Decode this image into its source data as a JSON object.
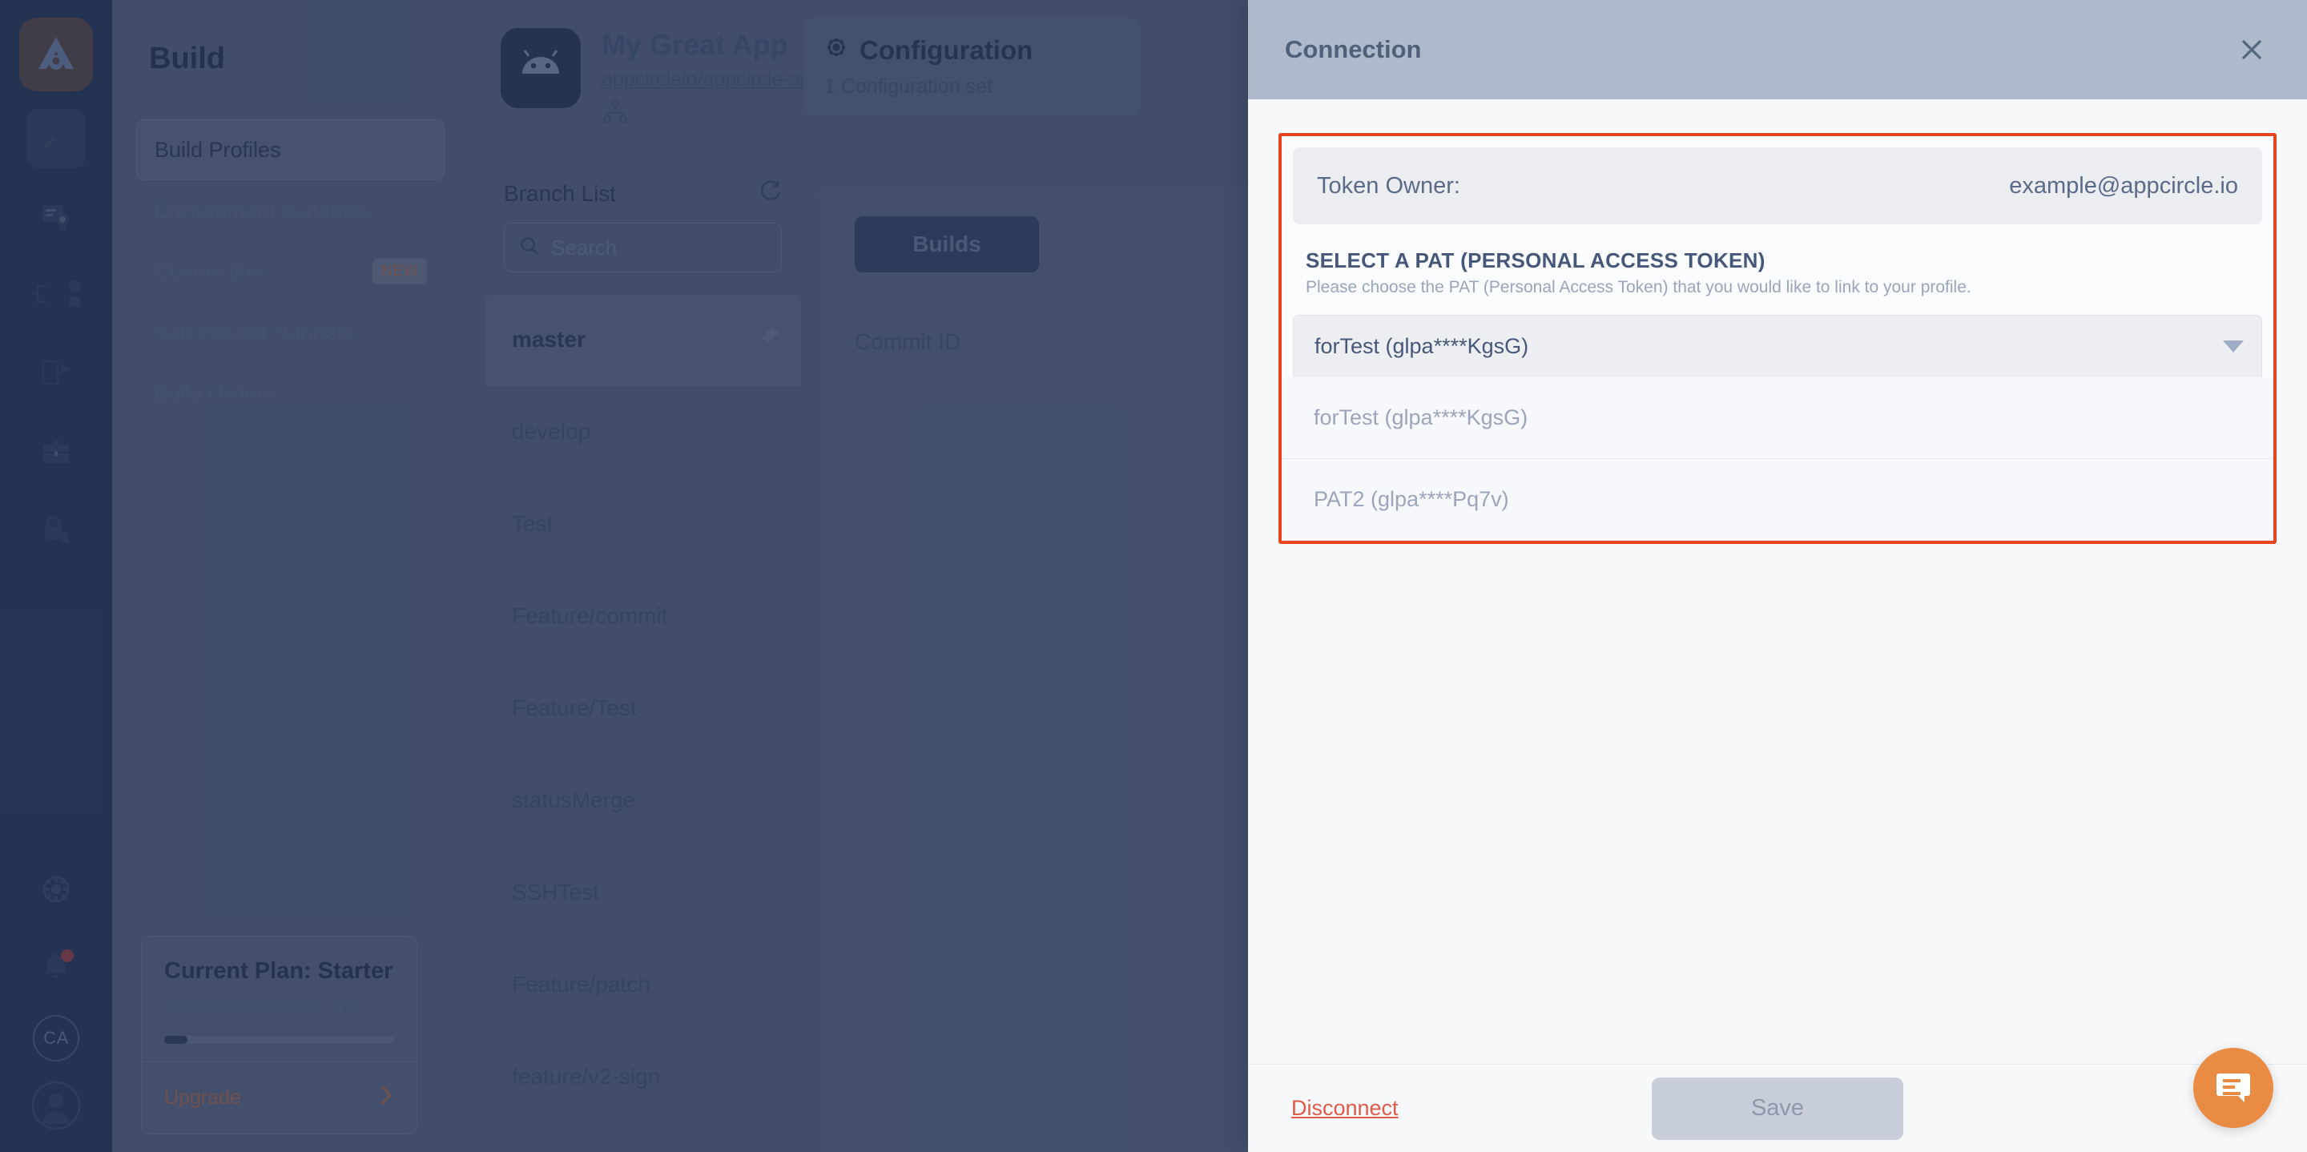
{
  "rail": {
    "items": [
      {
        "name": "appcircle-logo",
        "icon": "appcircle-logo-icon"
      },
      {
        "name": "build",
        "icon": "hammer-icon",
        "active": true
      },
      {
        "name": "signing-identities",
        "icon": "certificate-icon"
      },
      {
        "name": "distribution-flow",
        "icon": "flow-branch-icon"
      },
      {
        "name": "testing-distribution",
        "icon": "phone-send-icon"
      },
      {
        "name": "store-submit",
        "icon": "briefcase-icon"
      },
      {
        "name": "enterprise-app-store",
        "icon": "lock-person-icon"
      }
    ],
    "bottom": [
      {
        "name": "settings",
        "icon": "gear-icon"
      },
      {
        "name": "notifications",
        "icon": "bell-icon"
      },
      {
        "name": "organization",
        "icon": "ca-avatar",
        "label": "CA"
      },
      {
        "name": "profile",
        "icon": "user-circle-icon"
      }
    ]
  },
  "leftnav": {
    "title": "Build",
    "items": [
      {
        "label": "Build Profiles",
        "selected": true,
        "badge": ""
      },
      {
        "label": "Environment Variables",
        "selected": false,
        "badge": ""
      },
      {
        "label": "Connections",
        "selected": false,
        "badge": "NEW"
      },
      {
        "label": "Self-Hosted Runners",
        "selected": false,
        "badge": ""
      },
      {
        "label": "Build History",
        "selected": false,
        "badge": ""
      }
    ],
    "plan": {
      "title": "Current Plan: Starter",
      "remaining": "Remaining Builds: 18",
      "progress_percent": 10,
      "upgrade_label": "Upgrade",
      "chevron": "chevron-right-icon"
    }
  },
  "app": {
    "name": "My Great App",
    "repo": "appcircleio/appcircle-sample-android",
    "platform_icon": "android-icon",
    "branch_icon": "git-branch-icon",
    "configuration": {
      "title": "Configuration",
      "subtitle": "1 Configuration set",
      "icon": "gear-icon"
    }
  },
  "branches": {
    "title": "Branch List",
    "refresh_icon": "refresh-icon",
    "search_placeholder": "Search",
    "search_value": "",
    "search_icon": "search-icon",
    "items": [
      {
        "name": "master",
        "active": true,
        "pin_icon": "pin-icon"
      },
      {
        "name": "develop",
        "active": false
      },
      {
        "name": "Test",
        "active": false
      },
      {
        "name": "Feature/commit",
        "active": false
      },
      {
        "name": "Feature/Test",
        "active": false
      },
      {
        "name": "statusMerge",
        "active": false
      },
      {
        "name": "SSHTest",
        "active": false
      },
      {
        "name": "Feature/patch",
        "active": false
      },
      {
        "name": "feature/v2-sign",
        "active": false
      }
    ]
  },
  "builds": {
    "tab_label": "Builds",
    "column_commit_id": "Commit ID"
  },
  "panel": {
    "title": "Connection",
    "close_icon": "close-icon",
    "token_owner_label": "Token Owner:",
    "token_owner_value": "example@appcircle.io",
    "pat_label": "SELECT A PAT (PERSONAL ACCESS TOKEN)",
    "pat_description": "Please choose the PAT (Personal Access Token) that you would like to link to your profile.",
    "selected_pat": "forTest (glpa****KgsG)",
    "dropdown_icon": "chevron-down-icon",
    "options": [
      "forTest (glpa****KgsG)",
      "PAT2 (glpa****Pq7v)"
    ],
    "disconnect_label": "Disconnect",
    "save_label": "Save",
    "highlight_color": "#e8441d"
  },
  "chat": {
    "icon": "chat-bubble-icon",
    "color": "#ea8b43"
  }
}
